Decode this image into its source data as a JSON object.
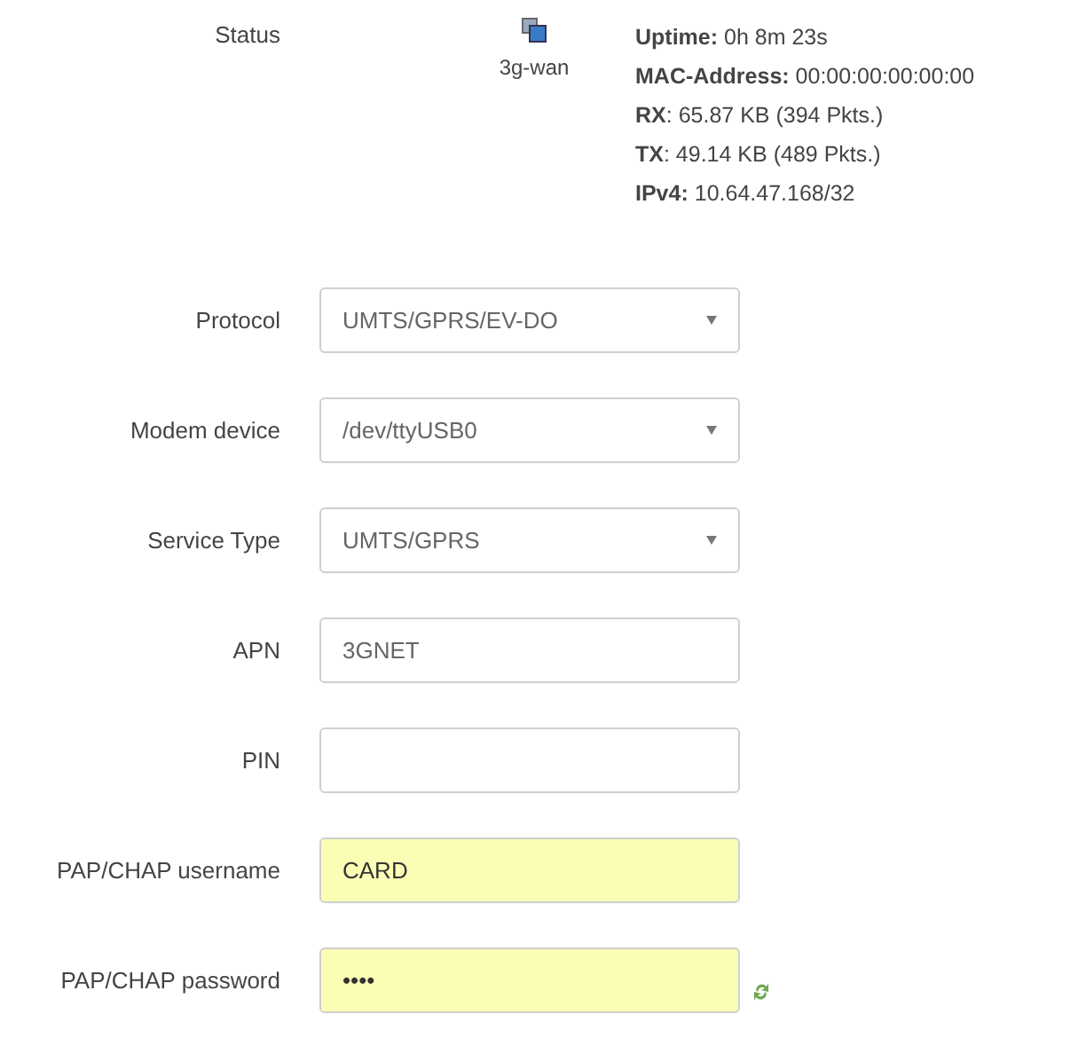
{
  "status": {
    "label": "Status",
    "interface": "3g-wan",
    "lines": [
      "**Uptime:** 0h 8m 23s",
      "**MAC-Address:** 00:00:00:00:00:00",
      "**RX**: 65.87 KB (394 Pkts.)",
      "**TX**: 49.14 KB (489 Pkts.)",
      "**IPv4:** 10.64.47.168/32"
    ]
  },
  "fields": [
    {
      "label": "Protocol",
      "kind": "select",
      "value": "UMTS/GPRS/EV-DO",
      "autofilled": false
    },
    {
      "label": "Modem device",
      "kind": "select",
      "value": "/dev/ttyUSB0",
      "autofilled": false
    },
    {
      "label": "Service Type",
      "kind": "select",
      "value": "UMTS/GPRS",
      "autofilled": false
    },
    {
      "label": "APN",
      "kind": "text",
      "value": "3GNET",
      "autofilled": false
    },
    {
      "label": "PIN",
      "kind": "text",
      "autofilled": false
    },
    {
      "label": "PAP/CHAP username",
      "kind": "text",
      "value": "CARD",
      "autofilled": true
    },
    {
      "label": "PAP/CHAP password",
      "kind": "password",
      "value": "••••",
      "autofilled": true
    }
  ]
}
